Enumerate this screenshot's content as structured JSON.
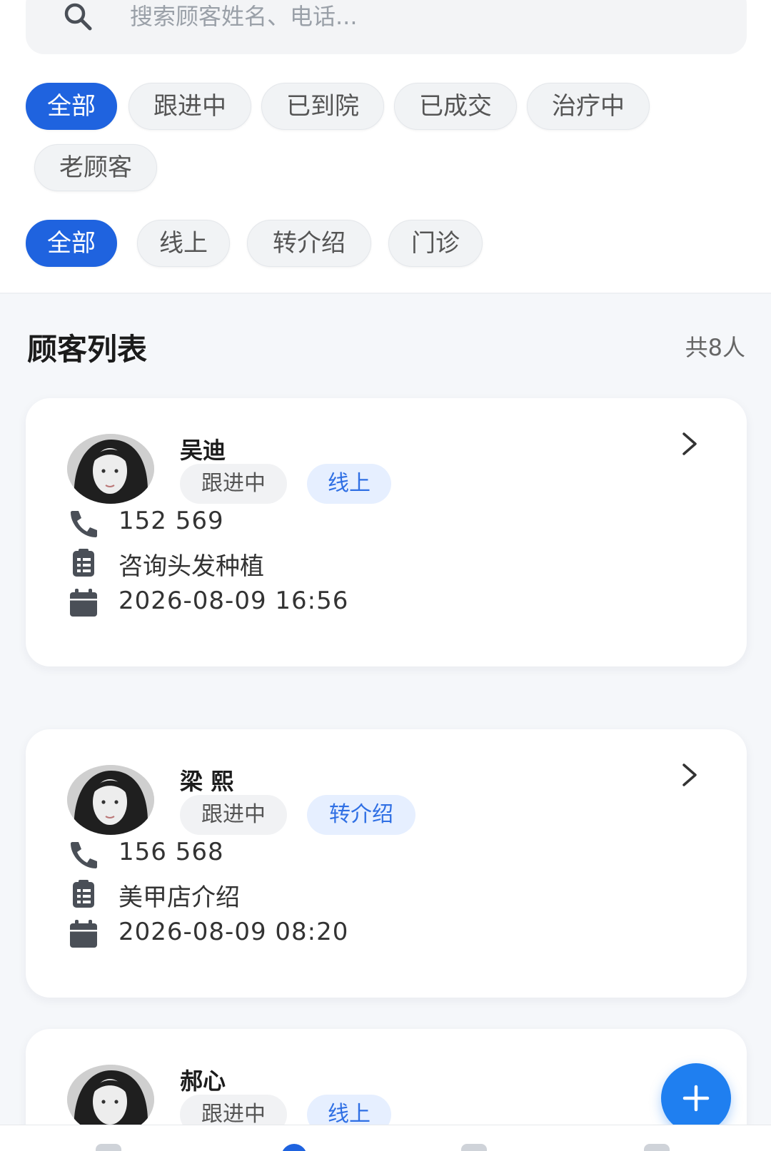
{
  "search": {
    "placeholder": "搜索顾客姓名、电话..."
  },
  "status_filters": [
    "全部",
    "跟进中",
    "已到院",
    "已成交",
    "治疗中",
    "老顾客"
  ],
  "source_filters": [
    "全部",
    "线上",
    "转介绍",
    "门诊"
  ],
  "list": {
    "title": "顾客列表",
    "count": "共8人"
  },
  "customers": [
    {
      "name": "吴迪",
      "status": "跟进中",
      "source": "线上",
      "phone": "152  569",
      "note": "咨询头发种植",
      "time": "2026-08-09 16:56"
    },
    {
      "name": "梁 熙",
      "status": "跟进中",
      "source": "转介绍",
      "phone": "156  568",
      "note": "美甲店介绍",
      "time": "2026-08-09 08:20"
    },
    {
      "name": "郝心",
      "status": "跟进中",
      "source": "线上"
    }
  ],
  "icons": {
    "search": "search-icon",
    "avatar": "avatar",
    "arrow": "chevron-right-icon",
    "phone": "phone-icon",
    "note": "clipboard-icon",
    "time": "calendar-icon",
    "add": "plus-icon"
  },
  "colors": {
    "accent": "#1f63df",
    "tag_source_bg": "#e6efff",
    "tag_source_text": "#2f6fe4",
    "fab": "#1f7ff0",
    "page_bg": "#f5f7fa"
  }
}
